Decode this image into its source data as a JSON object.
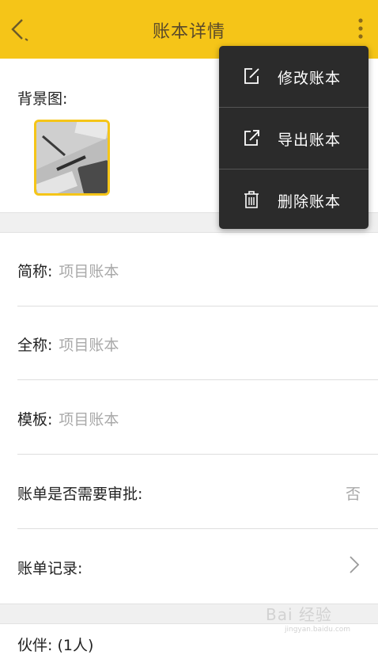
{
  "header": {
    "title": "账本详情",
    "color": "#f5c518"
  },
  "background": {
    "label": "背景图:"
  },
  "fields": {
    "short_name_label": "简称:",
    "short_name_value": "项目账本",
    "full_name_label": "全称:",
    "full_name_value": "项目账本",
    "template_label": "模板:",
    "template_value": "项目账本",
    "approval_label": "账单是否需要审批:",
    "approval_value": "否",
    "records_label": "账单记录:"
  },
  "partial_row": {
    "label": "伙伴: (1人)"
  },
  "menu": {
    "items": [
      {
        "label": "修改账本",
        "icon": "edit-icon"
      },
      {
        "label": "导出账本",
        "icon": "export-icon"
      },
      {
        "label": "删除账本",
        "icon": "trash-icon"
      }
    ]
  },
  "watermark": {
    "text": "Bai 经验",
    "sub": "jingyan.baidu.com"
  }
}
